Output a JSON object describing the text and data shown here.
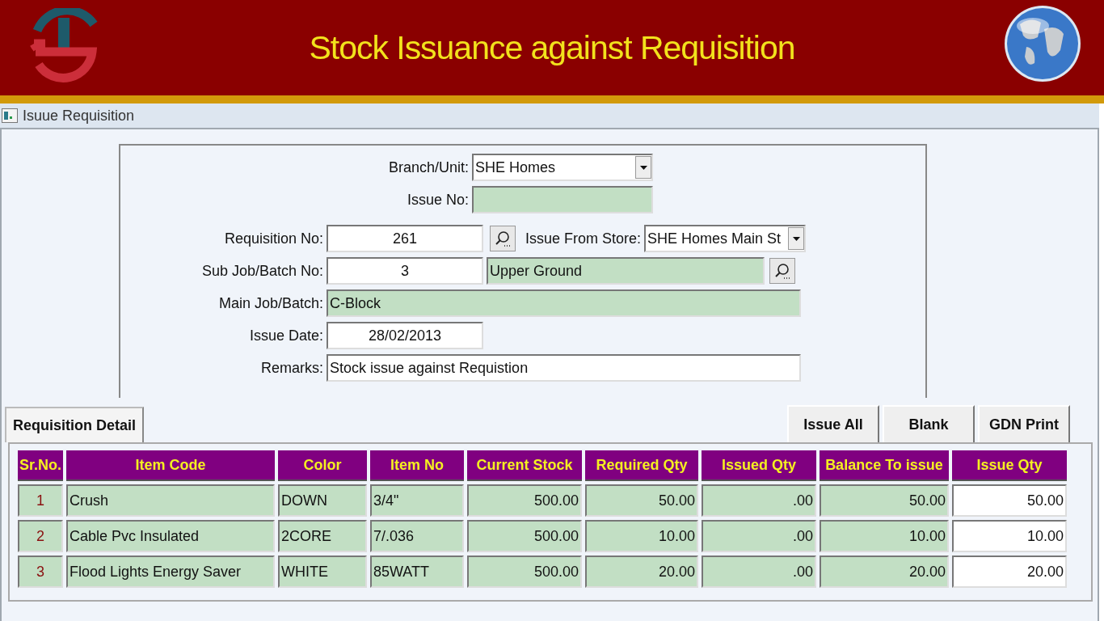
{
  "header": {
    "title": "Stock Issuance against Requisition"
  },
  "window": {
    "title": "Isuue Requisition"
  },
  "form": {
    "branch_unit": {
      "label": "Branch/Unit:",
      "value": "SHE Homes"
    },
    "issue_no": {
      "label": "Issue No:"
    },
    "requisition_no": {
      "label": "Requisition No:",
      "value": "261"
    },
    "issue_from_store": {
      "label": "Issue From Store:",
      "value": "SHE Homes Main St"
    },
    "sub_job_batch_no": {
      "label": "Sub Job/Batch No:",
      "value": "3",
      "description": "Upper Ground"
    },
    "main_job_batch": {
      "label": "Main Job/Batch:",
      "value": "C-Block"
    },
    "issue_date": {
      "label": "Issue Date:",
      "value": "28/02/2013"
    },
    "remarks": {
      "label": "Remarks:",
      "value": "Stock issue against Requistion"
    }
  },
  "tabs": [
    {
      "label": "Requisition Detail",
      "selected": true
    }
  ],
  "buttons": [
    "Issue All",
    "Blank",
    "GDN Print"
  ],
  "table": {
    "columns": [
      {
        "label": "Sr.No.",
        "kind": "serial"
      },
      {
        "label": "Item Code",
        "kind": "text"
      },
      {
        "label": "Color",
        "kind": "text"
      },
      {
        "label": "Item No",
        "kind": "text"
      },
      {
        "label": "Current Stock",
        "kind": "number"
      },
      {
        "label": "Required Qty",
        "kind": "number"
      },
      {
        "label": "Issued Qty",
        "kind": "number"
      },
      {
        "label": "Balance To issue",
        "kind": "number"
      },
      {
        "label": "Issue Qty",
        "kind": "input"
      }
    ],
    "rows": [
      [
        "1",
        "Crush",
        "DOWN",
        "3/4\"",
        "500.00",
        "50.00",
        ".00",
        "50.00",
        "50.00"
      ],
      [
        "2",
        "Cable Pvc Insulated",
        "2CORE",
        "7/.036",
        "500.00",
        "10.00",
        ".00",
        "10.00",
        "10.00"
      ],
      [
        "3",
        "Flood Lights Energy Saver",
        "WHITE",
        "85WATT",
        "500.00",
        "20.00",
        ".00",
        "20.00",
        "20.00"
      ]
    ]
  }
}
